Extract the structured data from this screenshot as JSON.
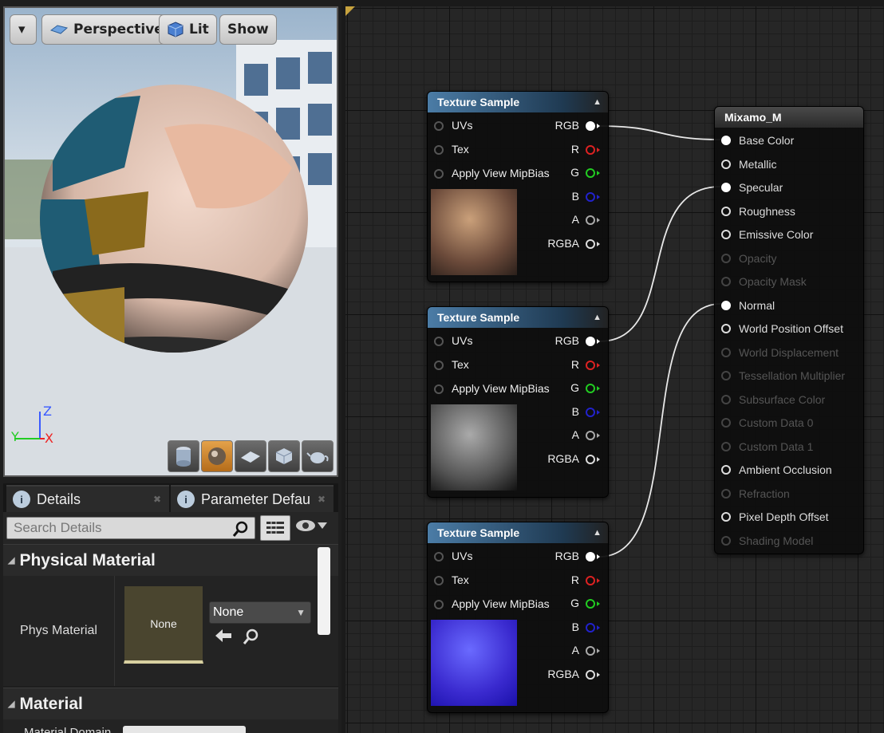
{
  "viewport": {
    "menu_label": "▾",
    "buttons": {
      "perspective": "Perspective",
      "lit": "Lit",
      "show": "Show"
    },
    "axis": {
      "z": "Z",
      "y": "Y",
      "x": "X"
    }
  },
  "details": {
    "tabs": [
      "Details",
      "Parameter Defau"
    ],
    "search_placeholder": "Search Details",
    "categories": {
      "physical": "Physical Material",
      "material": "Material"
    },
    "phys_material": {
      "label": "Phys Material",
      "thumb": "None",
      "combo": "None"
    },
    "material_sub_label": "Material Domain"
  },
  "graph": {
    "texture_nodes": [
      {
        "title": "Texture Sample",
        "inputs": [
          "UVs",
          "Tex",
          "Apply View MipBias"
        ],
        "outputs": [
          "RGB",
          "R",
          "G",
          "B",
          "A",
          "RGBA"
        ]
      },
      {
        "title": "Texture Sample",
        "inputs": [
          "UVs",
          "Tex",
          "Apply View MipBias"
        ],
        "outputs": [
          "RGB",
          "R",
          "G",
          "B",
          "A",
          "RGBA"
        ]
      },
      {
        "title": "Texture Sample",
        "inputs": [
          "UVs",
          "Tex",
          "Apply View MipBias"
        ],
        "outputs": [
          "RGB",
          "R",
          "G",
          "B",
          "A",
          "RGBA"
        ]
      }
    ],
    "material_node": {
      "title": "Mixamo_M",
      "pins": [
        {
          "label": "Base Color",
          "state": "connected"
        },
        {
          "label": "Metallic",
          "state": "enabled"
        },
        {
          "label": "Specular",
          "state": "connected"
        },
        {
          "label": "Roughness",
          "state": "enabled"
        },
        {
          "label": "Emissive Color",
          "state": "enabled"
        },
        {
          "label": "Opacity",
          "state": "disabled"
        },
        {
          "label": "Opacity Mask",
          "state": "disabled"
        },
        {
          "label": "Normal",
          "state": "connected"
        },
        {
          "label": "World Position Offset",
          "state": "enabled"
        },
        {
          "label": "World Displacement",
          "state": "disabled"
        },
        {
          "label": "Tessellation Multiplier",
          "state": "disabled"
        },
        {
          "label": "Subsurface Color",
          "state": "disabled"
        },
        {
          "label": "Custom Data 0",
          "state": "disabled"
        },
        {
          "label": "Custom Data 1",
          "state": "disabled"
        },
        {
          "label": "Ambient Occlusion",
          "state": "enabled"
        },
        {
          "label": "Refraction",
          "state": "disabled"
        },
        {
          "label": "Pixel Depth Offset",
          "state": "enabled"
        },
        {
          "label": "Shading Model",
          "state": "disabled"
        }
      ]
    },
    "pin_colors": {
      "R": "#d22",
      "G": "#2c2",
      "B": "#22c",
      "A": "#aaa",
      "RGB": "#fff",
      "RGBA": "#ddd"
    }
  }
}
